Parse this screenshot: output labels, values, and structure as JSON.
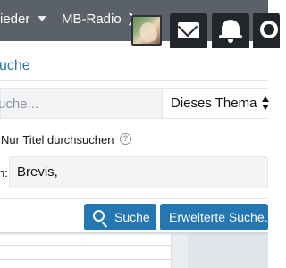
{
  "nav": {
    "members_label": "ieder",
    "radio_label": "MB-Radio",
    "icons": [
      "chevron-right-icon",
      "avatar",
      "mail-icon",
      "bell-icon",
      "search-icon"
    ]
  },
  "search_panel": {
    "title": "uche",
    "keyword_placeholder": "uche...",
    "scope_value": "Dieses Thema",
    "titles_only_label": "Nur Titel durchsuchen",
    "member_label": "n:",
    "member_value": "Brevis,",
    "search_button_label": "Suche",
    "advanced_button_label": "Erweiterte Suche..."
  },
  "colors": {
    "nav_bg": "#5b6168",
    "icon_btn_bg": "#22252a",
    "accent": "#2577b1",
    "input_bg": "#f3f4f6"
  }
}
